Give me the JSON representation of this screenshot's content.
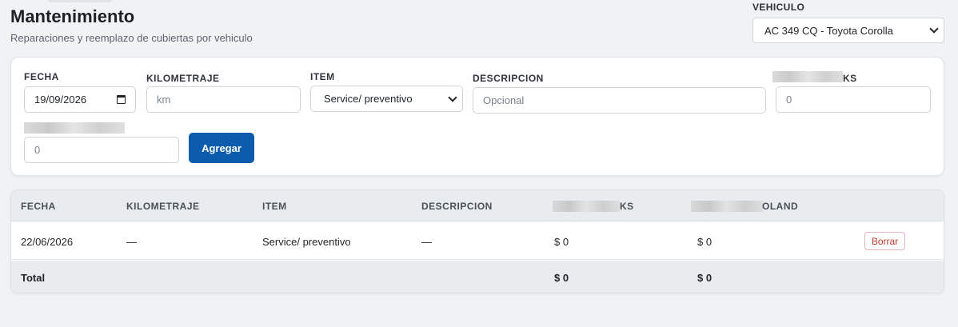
{
  "header": {
    "title": "Mantenimiento",
    "subtitle": "Reparaciones y reemplazo de cubiertas por vehiculo"
  },
  "vehicle": {
    "label": "VEHICULO",
    "selected": "AC 349 CQ - Toyota Corolla"
  },
  "form": {
    "fecha_label": "FECHA",
    "fecha_value": "19/09/2026",
    "km_label": "KILOMETRAJE",
    "km_placeholder": "km",
    "item_label": "ITEM",
    "item_selected": "Service/ preventivo",
    "desc_label": "DESCRIPCION",
    "desc_placeholder": "Opcional",
    "cost1_label_visible": "KS",
    "cost1_placeholder": "0",
    "cost2_placeholder": "0",
    "submit_label": "Agregar"
  },
  "table": {
    "headers": [
      "FECHA",
      "KILOMETRAJE",
      "ITEM",
      "DESCRIPCION",
      "KS",
      "OLAND"
    ],
    "rows": [
      {
        "fecha": "22/06/2026",
        "km": "—",
        "item": "Service/ preventivo",
        "descripcion": "—",
        "cost1": "$ 0",
        "cost2": "$ 0",
        "action": "Borrar"
      }
    ],
    "footer": {
      "label": "Total",
      "cost1": "$ 0",
      "cost2": "$ 0"
    }
  },
  "colors": {
    "primary": "#0b5cad",
    "danger": "#c0392b",
    "background": "#f1f2f4"
  }
}
